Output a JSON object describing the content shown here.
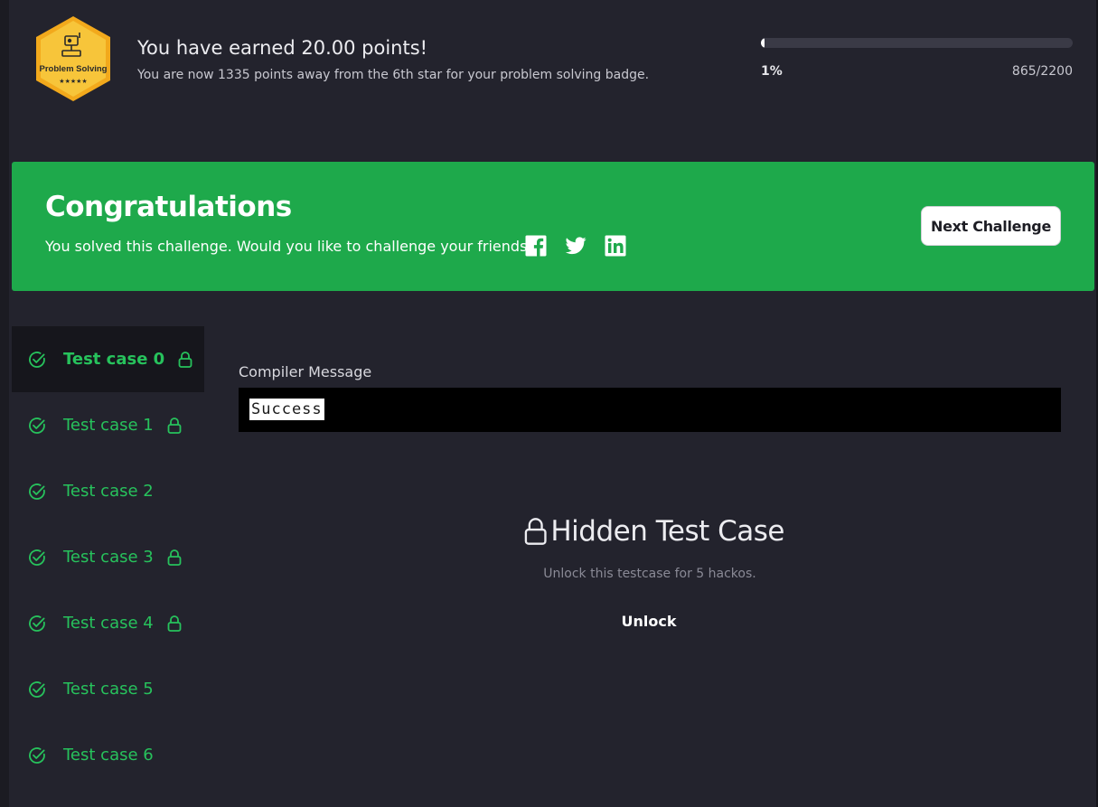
{
  "header": {
    "badge": {
      "label": "Problem Solving",
      "stars": "★★★★★",
      "icon": "robot-icon",
      "color": "#f5b82e"
    },
    "points_title": "You have earned 20.00 points!",
    "points_subtitle": "You are now 1335 points away from the 6th star for your problem solving badge.",
    "progress": {
      "percent_label": "1%",
      "fraction": 0.01,
      "count_label": "865/2200"
    }
  },
  "banner": {
    "title": "Congratulations",
    "subtitle": "You solved this challenge. Would you like to challenge your friends?",
    "share_icons": [
      "facebook-icon",
      "twitter-icon",
      "linkedin-icon"
    ],
    "next_button": "Next Challenge",
    "color": "#1ea94b"
  },
  "test_cases": [
    {
      "label": "Test case 0",
      "locked": true,
      "active": true
    },
    {
      "label": "Test case 1",
      "locked": true,
      "active": false
    },
    {
      "label": "Test case 2",
      "locked": false,
      "active": false
    },
    {
      "label": "Test case 3",
      "locked": true,
      "active": false
    },
    {
      "label": "Test case 4",
      "locked": true,
      "active": false
    },
    {
      "label": "Test case 5",
      "locked": false,
      "active": false
    },
    {
      "label": "Test case 6",
      "locked": false,
      "active": false
    }
  ],
  "main": {
    "compiler_label": "Compiler Message",
    "compiler_output": "Success",
    "hidden_title": "Hidden Test Case",
    "hidden_subtitle": "Unlock this testcase for 5 hackos.",
    "unlock_label": "Unlock"
  },
  "colors": {
    "background": "#23232d",
    "accent_green": "#27c25c"
  }
}
